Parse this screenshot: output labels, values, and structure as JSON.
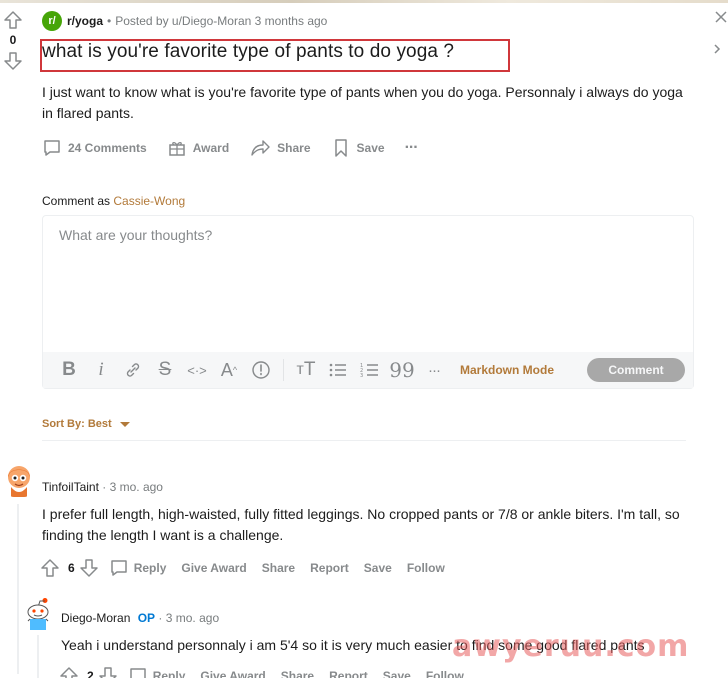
{
  "post": {
    "vote_count": "0",
    "subreddit_icon_text": "r/",
    "subreddit": "r/yoga",
    "posted_by": "Posted by u/Diego-Moran 3 months ago",
    "title": "what is you're favorite type of pants to do yoga ?",
    "body": "I just want to know what is you're favorite type of pants when you do yoga. Personnaly i always do yoga in flared pants.",
    "actions": {
      "comments": "24 Comments",
      "award": "Award",
      "share": "Share",
      "save": "Save",
      "more": "···"
    }
  },
  "composer": {
    "comment_as_label": "Comment as",
    "username": "Cassie-Wong",
    "placeholder": "What are your thoughts?",
    "markdown_mode": "Markdown Mode",
    "comment_button": "Comment",
    "toolbar_icons": [
      "bold-icon",
      "italic-icon",
      "link-icon",
      "strikethrough-icon",
      "inline-code-icon",
      "superscript-icon",
      "spoiler-icon",
      "heading-icon",
      "bulleted-list-icon",
      "numbered-list-icon",
      "quote-block-icon",
      "more-icon"
    ]
  },
  "sort": {
    "label": "Sort By: Best"
  },
  "comments": [
    {
      "author": "TinfoilTaint",
      "time": "3 mo. ago",
      "body": "I prefer full length, high-waisted, fully fitted leggings. No cropped pants or 7/8 or ankle biters. I'm tall, so finding the length I want is a challenge.",
      "score": "6",
      "actions": [
        "Reply",
        "Give Award",
        "Share",
        "Report",
        "Save",
        "Follow"
      ]
    },
    {
      "author": "Diego-Moran",
      "op_badge": "OP",
      "time": "3 mo. ago",
      "body": "Yeah i understand personnaly i am 5'4 so it is very much easier to find some good flared pants",
      "score": "2",
      "actions": [
        "Reply",
        "Give Award",
        "Share",
        "Report",
        "Save",
        "Follow"
      ]
    }
  ],
  "watermark": "awyeruu.com",
  "colors": {
    "accent": "#b27a3a",
    "subreddit_green": "#46a508",
    "highlight_box": "#d0373b",
    "op_blue": "#0079d3",
    "muted": "#878a8c"
  }
}
